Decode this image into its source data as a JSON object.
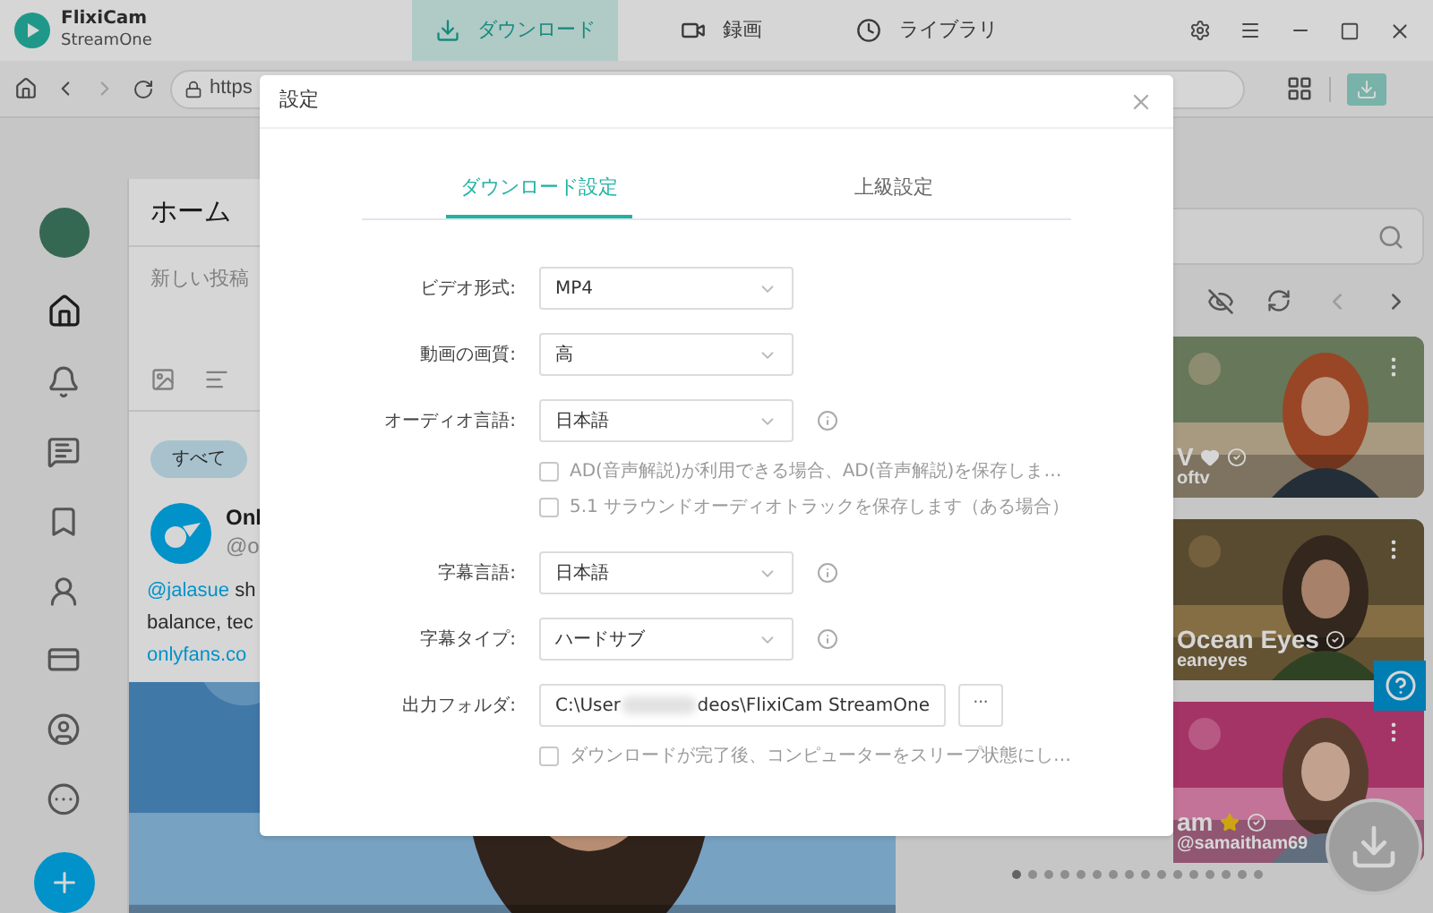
{
  "app": {
    "name": "FlixiCam",
    "subtitle": "StreamOne"
  },
  "nav_tabs": [
    {
      "label": "ダウンロード",
      "selected": true
    },
    {
      "label": "録画",
      "selected": false
    },
    {
      "label": "ライブラリ",
      "selected": false
    }
  ],
  "browser": {
    "url": "https"
  },
  "site": {
    "header": "ホーム",
    "composer_placeholder": "新しい投稿",
    "filter_chip": "すべて",
    "post": {
      "author": "Onl",
      "handle": "@o",
      "mention": "@jalasue",
      "line_1": " sh",
      "line_2": "balance, tec",
      "link": "onlyfans.co"
    },
    "cards": [
      {
        "name": "V",
        "kind": "heart",
        "handle": "oftv"
      },
      {
        "name": "Ocean Eyes",
        "kind": "plain",
        "handle": "eaneyes"
      },
      {
        "name": "am",
        "kind": "star",
        "handle": "@samaitham69"
      }
    ]
  },
  "dialog": {
    "title": "設定",
    "tabs": [
      {
        "label": "ダウンロード設定",
        "selected": true
      },
      {
        "label": "上級設定",
        "selected": false
      }
    ],
    "rows": [
      {
        "kind": "select",
        "label": "ビデオ形式:",
        "value": "MP4",
        "info": false
      },
      {
        "kind": "select",
        "label": "動画の画質:",
        "value": "高",
        "info": false
      },
      {
        "kind": "select",
        "label": "オーディオ言語:",
        "value": "日本語",
        "info": true
      },
      {
        "kind": "checkbox",
        "label": "AD(音声解説)が利用できる場合、AD(音声解説)を保存しま…",
        "checked": false
      },
      {
        "kind": "checkbox",
        "label": "5.1 サラウンドオーディオトラックを保存します（ある場合）",
        "checked": false
      },
      {
        "kind": "select",
        "label": "字幕言語:",
        "value": "日本語",
        "info": true
      },
      {
        "kind": "select",
        "label": "字幕タイプ:",
        "value": "ハードサブ",
        "info": true
      },
      {
        "kind": "folder",
        "label": "出力フォルダ:",
        "value_start": "C:\\User",
        "value_end": "deos\\FlixiCam StreamOne",
        "browse": "···"
      },
      {
        "kind": "checkbox",
        "label": "ダウンロードが完了後、コンピューターをスリープ状態にし…",
        "checked": false
      }
    ]
  }
}
